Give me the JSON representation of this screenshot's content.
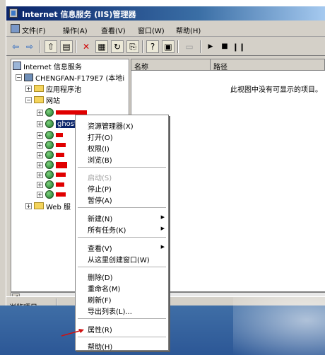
{
  "window": {
    "title": "Internet 信息服务 (IIS)管理器"
  },
  "menubar": {
    "items": [
      "文件(F)",
      "操作(A)",
      "查看(V)",
      "窗口(W)",
      "帮助(H)"
    ]
  },
  "toolbar": {
    "buttons": [
      "back-icon",
      "forward-icon",
      "up-folder-icon",
      "show-tree-icon",
      "delete-icon",
      "properties-icon",
      "refresh-icon",
      "export-icon",
      "help-icon",
      "console-icon",
      "computer-icon",
      "play-icon",
      "stop-icon",
      "pause-icon"
    ]
  },
  "tree": {
    "root": "Internet 信息服务",
    "server": "CHENGFAN-F179E7 (本地i",
    "app_pools": "应用程序池",
    "websites": "网站",
    "selected_site": "ghost....",
    "web_ext": "Web 服"
  },
  "list": {
    "columns": [
      "名称",
      "路径"
    ],
    "empty_message": "此视图中没有可显示的项目。"
  },
  "context_menu": {
    "group1": [
      "资源管理器(X)",
      "打开(O)",
      "权限(I)",
      "浏览(B)"
    ],
    "group2": [
      "启动(S)",
      "停止(P)",
      "暂停(A)"
    ],
    "group3": [
      "新建(N)",
      "所有任务(K)"
    ],
    "group4": [
      "查看(V)",
      "从这里创建窗口(W)"
    ],
    "group5": [
      "删除(D)",
      "重命名(M)",
      "刷新(F)",
      "导出列表(L)..."
    ],
    "group6": [
      "属性(R)"
    ],
    "group7": [
      "帮助(H)"
    ]
  },
  "status": {
    "text": "浏览项目"
  },
  "colors": {
    "titlebar": "#0a246a",
    "redaction": "#e00000",
    "selection": "#0a246a",
    "annotation_arrow": "#d01010"
  }
}
